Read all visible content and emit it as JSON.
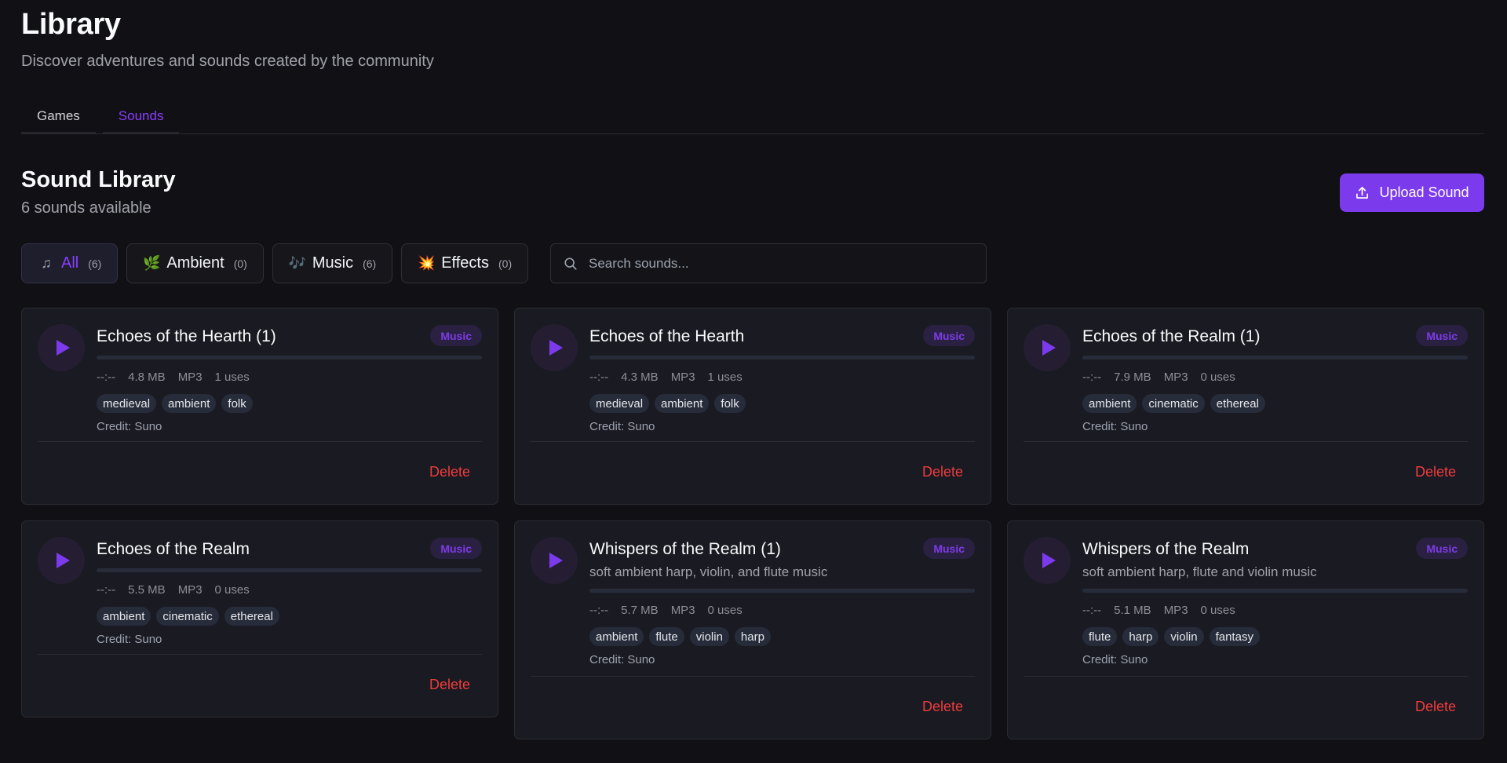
{
  "header": {
    "title": "Library",
    "subtitle": "Discover adventures and sounds created by the community"
  },
  "tabs": [
    {
      "label": "Games",
      "active": false
    },
    {
      "label": "Sounds",
      "active": true
    }
  ],
  "section": {
    "title": "Sound Library",
    "count": "6 sounds available",
    "upload_label": "Upload Sound"
  },
  "filters": [
    {
      "icon": "music-note-icon",
      "glyph": "♫",
      "label": "All",
      "count": "(6)",
      "active": true
    },
    {
      "icon": "leaf-icon",
      "glyph": "🌿",
      "label": "Ambient",
      "count": "(0)",
      "active": false
    },
    {
      "icon": "music-notes-icon",
      "glyph": "🎶",
      "label": "Music",
      "count": "(6)",
      "active": false
    },
    {
      "icon": "explosion-icon",
      "glyph": "💥",
      "label": "Effects",
      "count": "(0)",
      "active": false
    }
  ],
  "search": {
    "placeholder": "Search sounds..."
  },
  "colors": {
    "accent": "#7c3aed",
    "danger": "#ef3c3c",
    "background": "#111115"
  },
  "cards": [
    {
      "title": "Echoes of the Hearth (1)",
      "description": "",
      "badge": "Music",
      "duration": "--:--",
      "size": "4.8 MB",
      "format": "MP3",
      "uses": "1 uses",
      "tags": [
        "medieval",
        "ambient",
        "folk"
      ],
      "credit": "Credit: Suno",
      "delete_label": "Delete"
    },
    {
      "title": "Echoes of the Hearth",
      "description": "",
      "badge": "Music",
      "duration": "--:--",
      "size": "4.3 MB",
      "format": "MP3",
      "uses": "1 uses",
      "tags": [
        "medieval",
        "ambient",
        "folk"
      ],
      "credit": "Credit: Suno",
      "delete_label": "Delete"
    },
    {
      "title": "Echoes of the Realm (1)",
      "description": "",
      "badge": "Music",
      "duration": "--:--",
      "size": "7.9 MB",
      "format": "MP3",
      "uses": "0 uses",
      "tags": [
        "ambient",
        "cinematic",
        "ethereal"
      ],
      "credit": "Credit: Suno",
      "delete_label": "Delete"
    },
    {
      "title": "Echoes of the Realm",
      "description": "",
      "badge": "Music",
      "duration": "--:--",
      "size": "5.5 MB",
      "format": "MP3",
      "uses": "0 uses",
      "tags": [
        "ambient",
        "cinematic",
        "ethereal"
      ],
      "credit": "Credit: Suno",
      "delete_label": "Delete"
    },
    {
      "title": "Whispers of the Realm (1)",
      "description": "soft ambient harp, violin, and flute music",
      "badge": "Music",
      "duration": "--:--",
      "size": "5.7 MB",
      "format": "MP3",
      "uses": "0 uses",
      "tags": [
        "ambient",
        "flute",
        "violin",
        "harp"
      ],
      "credit": "Credit: Suno",
      "delete_label": "Delete"
    },
    {
      "title": "Whispers of the Realm",
      "description": "soft ambient harp, flute and violin music",
      "badge": "Music",
      "duration": "--:--",
      "size": "5.1 MB",
      "format": "MP3",
      "uses": "0 uses",
      "tags": [
        "flute",
        "harp",
        "violin",
        "fantasy"
      ],
      "credit": "Credit: Suno",
      "delete_label": "Delete"
    }
  ]
}
